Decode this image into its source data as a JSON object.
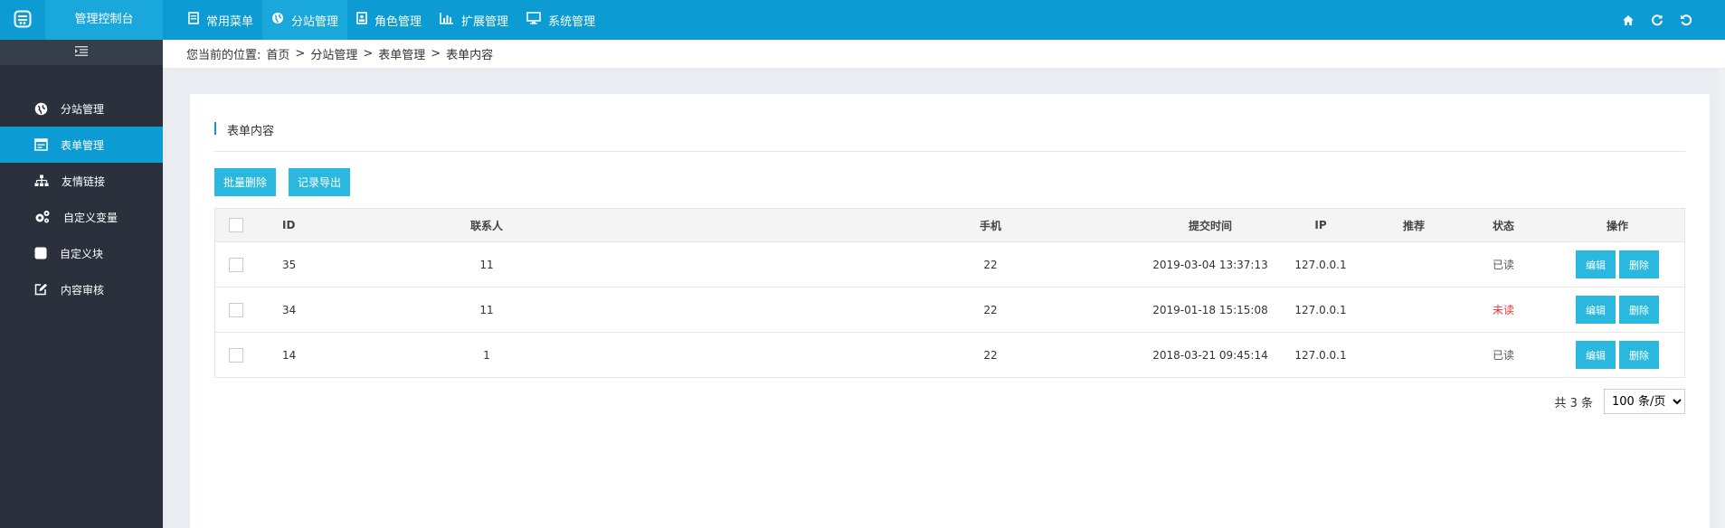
{
  "header": {
    "title": "管理控制台",
    "nav": [
      {
        "label": "常用菜单",
        "icon": "book-icon"
      },
      {
        "label": "分站管理",
        "icon": "globe-icon",
        "active": true
      },
      {
        "label": "角色管理",
        "icon": "id-card-icon"
      },
      {
        "label": "扩展管理",
        "icon": "bar-chart-icon"
      },
      {
        "label": "系统管理",
        "icon": "monitor-icon"
      }
    ],
    "tools": [
      "home-icon",
      "refresh-icon",
      "logout-icon"
    ]
  },
  "sidebar": {
    "items": [
      {
        "label": "分站管理",
        "icon": "globe-icon"
      },
      {
        "label": "表单管理",
        "icon": "form-icon",
        "active": true
      },
      {
        "label": "友情链接",
        "icon": "sitemap-icon"
      },
      {
        "label": "自定义变量",
        "icon": "cogs-icon"
      },
      {
        "label": "自定义块",
        "icon": "square-icon"
      },
      {
        "label": "内容审核",
        "icon": "edit-icon"
      }
    ]
  },
  "breadcrumb": {
    "prefix": "您当前的位置:",
    "items": [
      "首页",
      "分站管理",
      "表单管理",
      "表单内容"
    ],
    "separator": ">"
  },
  "panel": {
    "title": "表单内容",
    "batch_delete_label": "批量删除",
    "export_label": "记录导出"
  },
  "table": {
    "headers": {
      "id": "ID",
      "contact": "联系人",
      "phone": "手机",
      "time": "提交时间",
      "ip": "IP",
      "recommend": "推荐",
      "status": "状态",
      "ops": "操作"
    },
    "rows": [
      {
        "id": "35",
        "contact": "11",
        "phone": "22",
        "time": "2019-03-04 13:37:13",
        "ip": "127.0.0.1",
        "recommend": "",
        "status": "已读",
        "unread": false
      },
      {
        "id": "34",
        "contact": "11",
        "phone": "22",
        "time": "2019-01-18 15:15:08",
        "ip": "127.0.0.1",
        "recommend": "",
        "status": "未读",
        "unread": true
      },
      {
        "id": "14",
        "contact": "1",
        "phone": "22",
        "time": "2018-03-21 09:45:14",
        "ip": "127.0.0.1",
        "recommend": "",
        "status": "已读",
        "unread": false
      }
    ],
    "edit_label": "编辑",
    "delete_label": "删除"
  },
  "pager": {
    "total_text": "共 3 条",
    "page_size": "100 条/页"
  },
  "colors": {
    "primary": "#0c9bd2",
    "button": "#2bb8df",
    "sidebar": "#2b313c",
    "unread": "#e4393c"
  }
}
